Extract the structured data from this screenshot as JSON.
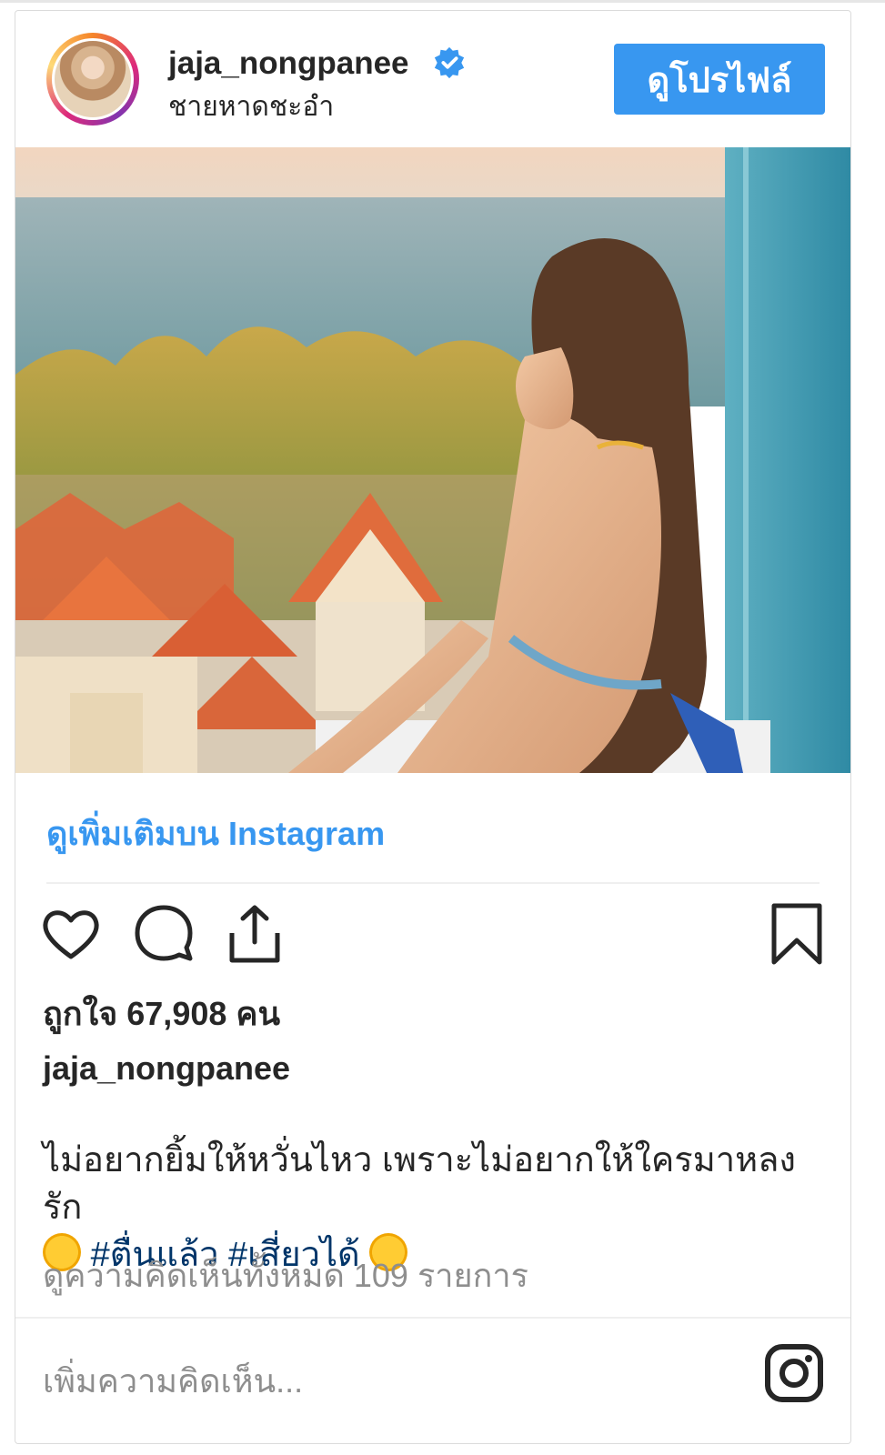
{
  "post": {
    "username": "jaja_nongpanee",
    "location": "ชายหาดชะอำ",
    "view_profile_label": "ดูโปรไฟล์",
    "view_more_label": "ดูเพิ่มเติมบน Instagram",
    "likes_text": "ถูกใจ 67,908 คน",
    "caption_user": "jaja_nongpanee",
    "caption_line1": "ไม่อยากยิ้มให้หวั่นไหว เพราะไม่อยากให้ใครมาหลงรัก",
    "hashtag1": "#ตื่นแล้ว",
    "hashtag2": "#เสี่ยวได้",
    "view_comments": "ดูความคิดเห็นทั้งหมด 109 รายการ",
    "add_comment_placeholder": "เพิ่มความคิดเห็น..."
  },
  "icons": {
    "verified": "verified-badge-icon",
    "like": "heart-icon",
    "comment": "comment-bubble-icon",
    "share": "share-icon",
    "save": "bookmark-icon",
    "instagram": "instagram-logo-icon"
  },
  "colors": {
    "accent": "#3897f0",
    "text": "#262626",
    "muted": "#8e8e8e",
    "hashtag": "#003569"
  }
}
